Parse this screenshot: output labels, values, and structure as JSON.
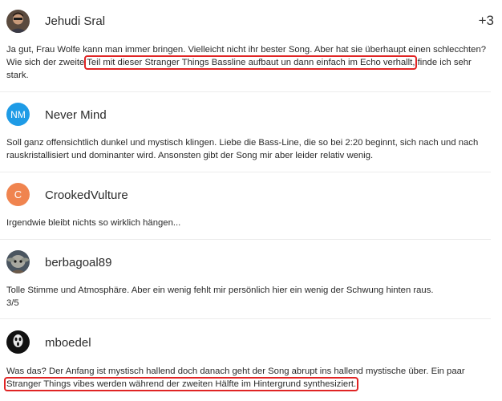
{
  "comments": [
    {
      "username": "Jehudi Sral",
      "extra": "+3",
      "text_before": "Ja gut, Frau Wolfe kann man immer bringen. Vielleicht nicht ihr bester Song. Aber hat sie überhaupt einen schlecchten? Wie sich der zweite ",
      "highlight": "Teil mit dieser Stranger Things Bassline aufbaut un dann einfach im Echo verhallt,",
      "text_after": " finde ich sehr stark."
    },
    {
      "username": "Never Mind",
      "avatar_initials": "NM",
      "avatar_color": "#1e9be6",
      "text": "Soll ganz offensichtlich dunkel und mystisch klingen. Liebe die Bass-Line, die so bei 2:20 beginnt, sich nach und nach rauskristallisiert und dominanter wird. Ansonsten gibt der Song mir aber leider relativ wenig."
    },
    {
      "username": "CrookedVulture",
      "avatar_initials": "C",
      "avatar_color": "#f0844f",
      "text": "Irgendwie bleibt nichts so wirklich hängen..."
    },
    {
      "username": "berbagoal89",
      "text_line1": "Tolle Stimme und Atmosphäre. Aber ein wenig fehlt mir persönlich hier ein wenig der Schwung hinten raus.",
      "text_line2": "3/5"
    },
    {
      "username": "mboedel",
      "text_before": "Was das? Der Anfang ist mystisch hallend doch danach geht der Song abrupt ins hallend mystische über. Ein paar ",
      "highlight": "Stranger Things vibes werden während der zweiten Hälfte im Hintergrund synthesiziert."
    }
  ],
  "colors": {
    "highlight_border": "#e02424",
    "divider": "#ececec"
  }
}
